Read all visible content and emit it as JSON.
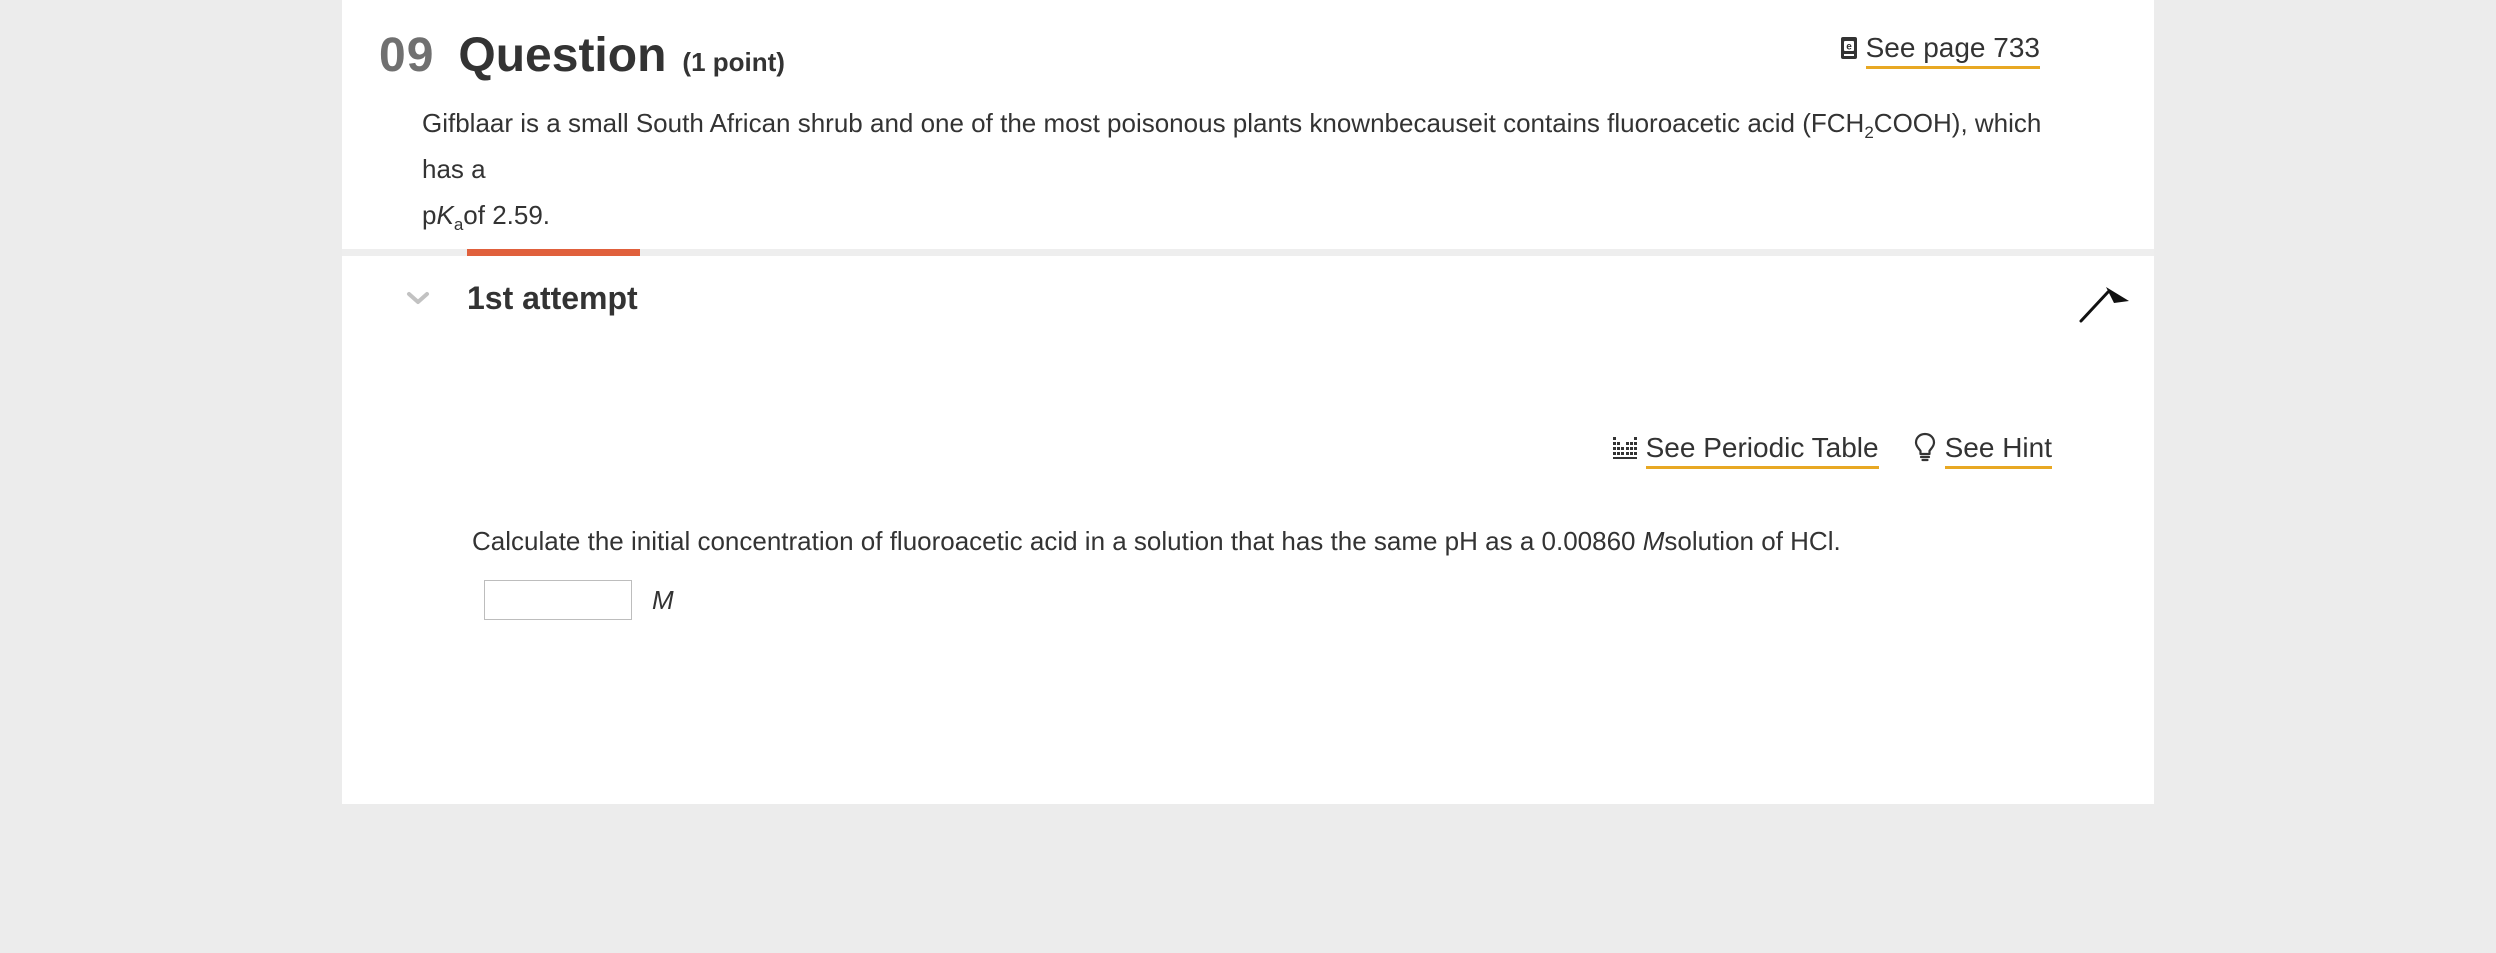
{
  "question": {
    "number": "09",
    "title": "Question",
    "points": "(1 point)",
    "see_page": "See page 733",
    "body": {
      "part1": "Gifblaar is a small South African shrub and one of the most poisonous plants knownbecauseit contains fluoroacetic acid (FCH",
      "sub1": "2",
      "part2": "COOH), which has a",
      "pk_p": "p",
      "pk_k": "K",
      "pk_a": "a",
      "part3": "of 2.59."
    }
  },
  "attempt": {
    "title": "1st attempt",
    "tools": {
      "periodic_table": "See Periodic Table",
      "hint": "See Hint"
    },
    "prompt": {
      "part1": "Calculate the initial concentration of fluoroacetic acid in a solution that has the same pH as a 0.00860 ",
      "unit": "M",
      "part2": "solution of HCl."
    },
    "answer": {
      "value": "",
      "placeholder": "",
      "unit": "M"
    }
  },
  "colors": {
    "accent": "#e0603c",
    "link_underline": "#e8a823",
    "background": "#ececec",
    "card": "#ffffff",
    "text": "#333333",
    "muted": "#707070"
  },
  "icons": {
    "see_page": "ebook-icon",
    "periodic_table": "periodic-table-icon",
    "hint": "lightbulb-icon",
    "collapse": "chevron-down-icon",
    "corner": "arrow-up-icon"
  }
}
